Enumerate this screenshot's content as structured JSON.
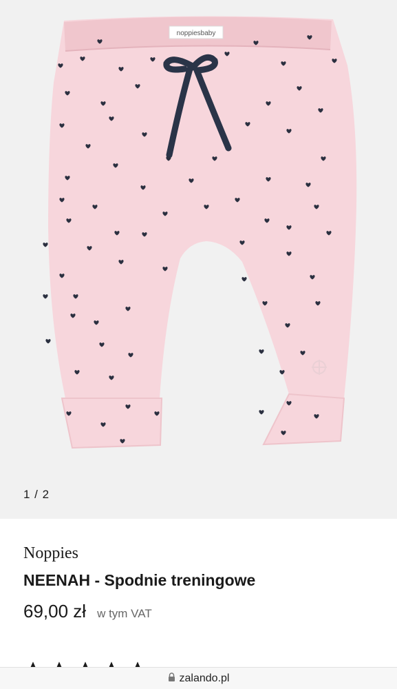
{
  "gallery": {
    "counter": "1 / 2",
    "label_text": "noppiesbaby",
    "colors": {
      "fabric": "#f7d6dc",
      "waistband": "#f0c6cd",
      "hearts": "#2b3040",
      "drawstring": "#2a3448",
      "background": "#f1f1f1"
    }
  },
  "product": {
    "brand": "Noppies",
    "name": "NEENAH - Spodnie treningowe",
    "price": "69,00 zł",
    "vat": "w tym VAT",
    "rating_stars": 5
  },
  "browser": {
    "url": "zalando.pl"
  }
}
